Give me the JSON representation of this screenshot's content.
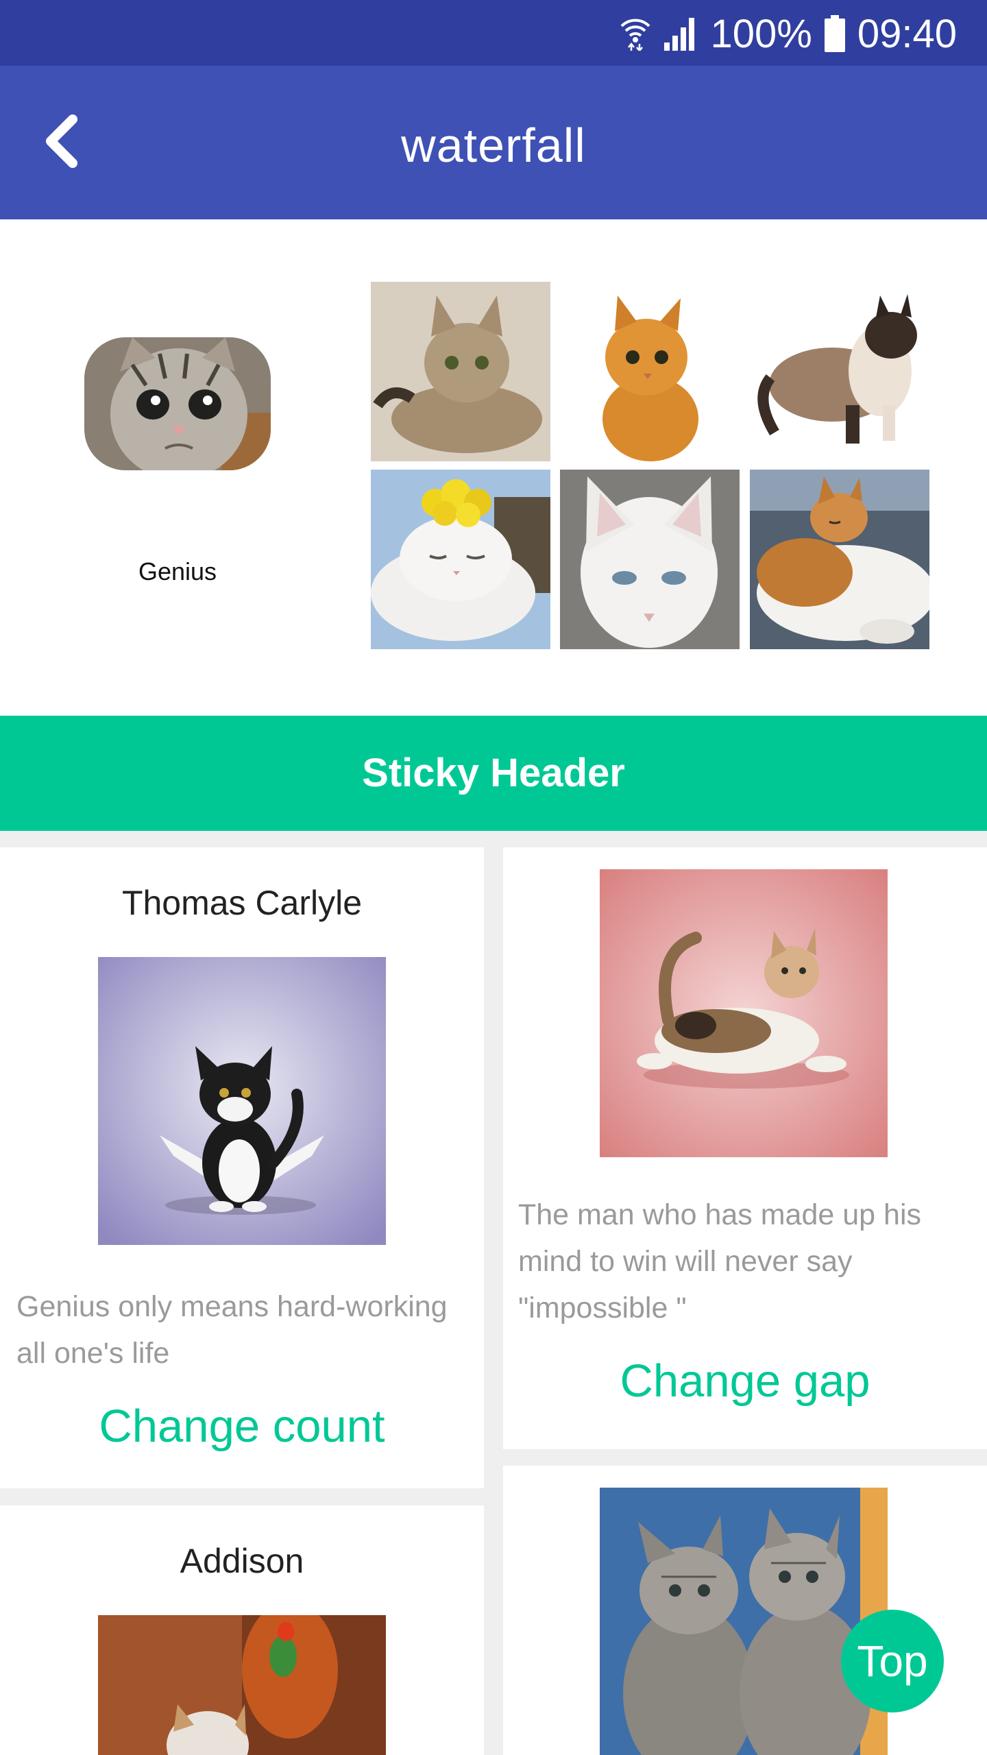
{
  "status_bar": {
    "battery": "100%",
    "time": "09:40"
  },
  "app_bar": {
    "title": "waterfall"
  },
  "header": {
    "avatar_label": "Genius"
  },
  "sticky_header": {
    "label": "Sticky Header"
  },
  "cards": [
    {
      "name": "Thomas Carlyle",
      "quote": "Genius only means hard-working all one's life",
      "action": "Change count"
    },
    {
      "name": "",
      "quote": "The man who has made up his mind to win will never say \"impossible \"",
      "action": "Change gap"
    },
    {
      "name": "Addison",
      "quote": "",
      "action": ""
    }
  ],
  "fab": {
    "label": "Top"
  },
  "colors": {
    "primary": "#3f51b5",
    "primary_dark": "#303f9f",
    "accent": "#00c895"
  }
}
